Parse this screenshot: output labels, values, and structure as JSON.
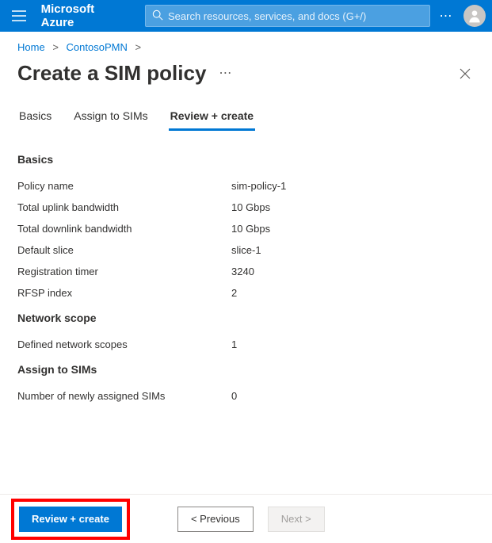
{
  "topbar": {
    "brand": "Microsoft Azure",
    "search_placeholder": "Search resources, services, and docs (G+/)"
  },
  "breadcrumb": {
    "items": [
      "Home",
      "ContosoPMN"
    ]
  },
  "page": {
    "title": "Create a SIM policy"
  },
  "tabs": {
    "items": [
      {
        "label": "Basics"
      },
      {
        "label": "Assign to SIMs"
      },
      {
        "label": "Review + create"
      }
    ],
    "active_index": 2
  },
  "sections": {
    "basics": {
      "heading": "Basics",
      "rows": [
        {
          "label": "Policy name",
          "value": "sim-policy-1"
        },
        {
          "label": "Total uplink bandwidth",
          "value": "10 Gbps"
        },
        {
          "label": "Total downlink bandwidth",
          "value": "10 Gbps"
        },
        {
          "label": "Default slice",
          "value": "slice-1"
        },
        {
          "label": "Registration timer",
          "value": "3240"
        },
        {
          "label": "RFSP index",
          "value": "2"
        }
      ]
    },
    "network_scope": {
      "heading": "Network scope",
      "rows": [
        {
          "label": "Defined network scopes",
          "value": "1"
        }
      ]
    },
    "assign_to_sims": {
      "heading": "Assign to SIMs",
      "rows": [
        {
          "label": "Number of newly assigned SIMs",
          "value": "0"
        }
      ]
    }
  },
  "footer": {
    "primary_label": "Review + create",
    "prev_label": "< Previous",
    "next_label": "Next >"
  }
}
